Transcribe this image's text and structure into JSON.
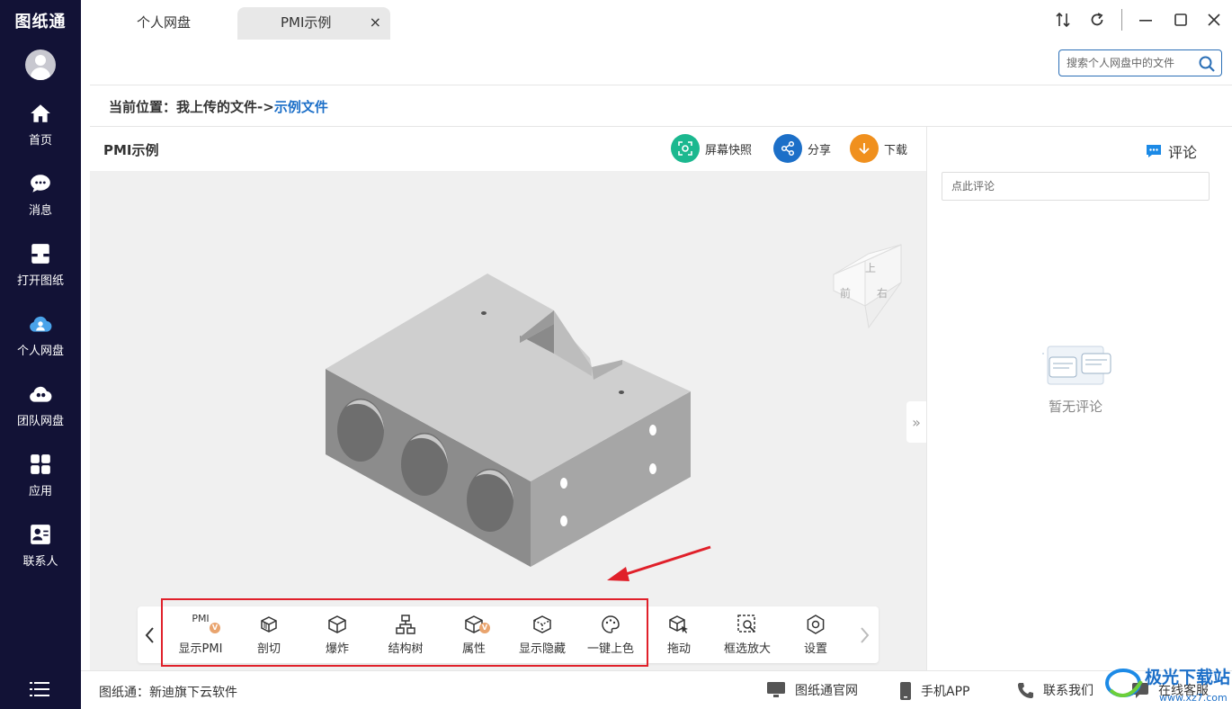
{
  "app": {
    "logo_text": "图纸通"
  },
  "sidebar": {
    "items": [
      {
        "label": "首页"
      },
      {
        "label": "消息"
      },
      {
        "label": "打开图纸"
      },
      {
        "label": "个人网盘"
      },
      {
        "label": "团队网盘"
      },
      {
        "label": "应用"
      },
      {
        "label": "联系人"
      }
    ]
  },
  "tabs": [
    {
      "label": "个人网盘"
    },
    {
      "label": "PMI示例",
      "close": "×",
      "active": true
    }
  ],
  "search": {
    "placeholder": "搜索个人网盘中的文件"
  },
  "breadcrumb": {
    "prefix": "当前位置：",
    "path": "我上传的文件->",
    "current": "示例文件"
  },
  "panel": {
    "title": "PMI示例",
    "actions": [
      {
        "label": "屏幕快照",
        "color": "#1bb88f"
      },
      {
        "label": "分享",
        "color": "#1c6fc8"
      },
      {
        "label": "下载",
        "color": "#f0901e"
      }
    ]
  },
  "viewcube": {
    "top": "上",
    "front": "前",
    "right": "右"
  },
  "toolbar": {
    "items": [
      {
        "label": "显示PMI",
        "icon_text": "PMI",
        "vip": "V"
      },
      {
        "label": "剖切"
      },
      {
        "label": "爆炸"
      },
      {
        "label": "结构树"
      },
      {
        "label": "属性",
        "vip": "V"
      },
      {
        "label": "显示隐藏"
      },
      {
        "label": "一键上色"
      },
      {
        "label": "拖动"
      },
      {
        "label": "框选放大"
      },
      {
        "label": "设置"
      }
    ],
    "highlight_color": "#e0202a"
  },
  "comments": {
    "title": "评论",
    "placeholder": "点此评论",
    "empty_text": "暂无评论"
  },
  "footer": {
    "text": "图纸通：新迪旗下云软件",
    "links": [
      {
        "label": "图纸通官网"
      },
      {
        "label": "手机APP"
      },
      {
        "label": "联系我们"
      },
      {
        "label": "在线客服"
      }
    ]
  },
  "watermark": {
    "text": "极光下载站",
    "url_text": "www.xz7.com"
  }
}
